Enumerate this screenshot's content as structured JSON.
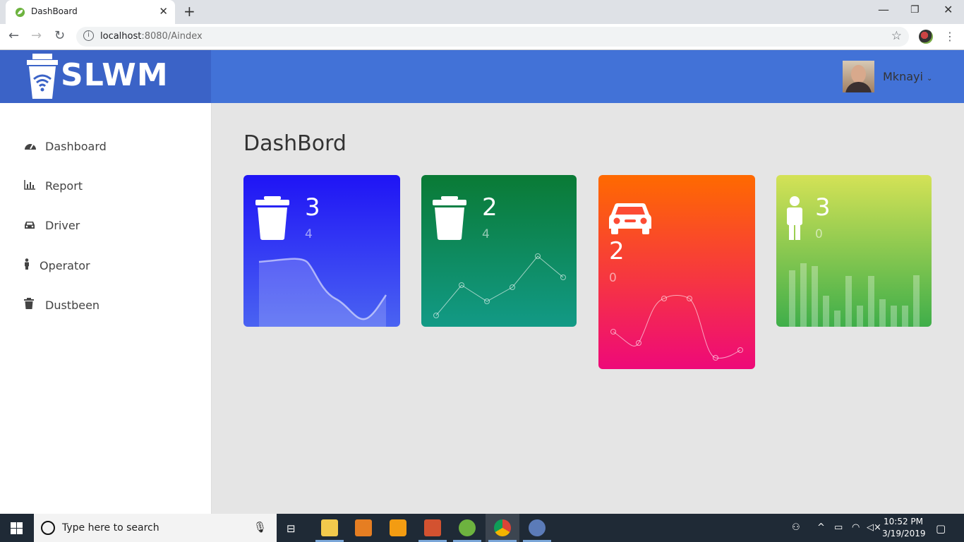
{
  "browser": {
    "tab_title": "DashBoard",
    "url_host": "localhost",
    "url_path": ":8080/Aindex"
  },
  "app": {
    "brand": "SLWM",
    "user": "Mknayi",
    "page_title": "DashBord"
  },
  "sidebar": {
    "items": [
      {
        "label": "Dashboard",
        "icon": "tachometer-icon"
      },
      {
        "label": "Report",
        "icon": "bar-chart-icon"
      },
      {
        "label": "Driver",
        "icon": "car-icon"
      },
      {
        "label": "Operator",
        "icon": "male-icon"
      },
      {
        "label": "Dustbeen",
        "icon": "trash-icon"
      }
    ]
  },
  "cards": [
    {
      "value": "3",
      "sub": "4",
      "icon": "trash-icon",
      "color_top": "#1f14f5",
      "color_bottom": "#4a63f2"
    },
    {
      "value": "2",
      "sub": "4",
      "icon": "trash-icon",
      "color_top": "#0a7a35",
      "color_bottom": "#129a86"
    },
    {
      "value": "2",
      "sub": "0",
      "icon": "car-icon",
      "color_top": "#ff6a00",
      "color_bottom": "#ee0979"
    },
    {
      "value": "3",
      "sub": "0",
      "icon": "male-icon",
      "color_top": "#d4e256",
      "color_bottom": "#3fae4a"
    }
  ],
  "taskbar": {
    "search_placeholder": "Type here to search",
    "time": "10:52 PM",
    "date": "3/19/2019"
  }
}
